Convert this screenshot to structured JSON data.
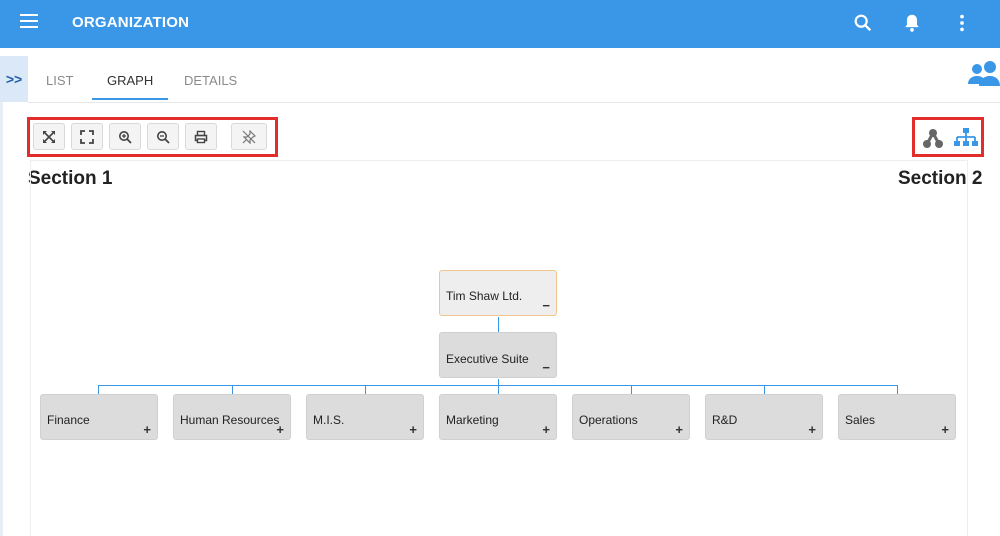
{
  "header": {
    "title": "ORGANIZATION",
    "icons": [
      "menu-icon",
      "search-icon",
      "bell-icon",
      "more-vertical-icon"
    ],
    "color": "#3a97e8"
  },
  "tabs": {
    "toggle": ">>",
    "items": [
      {
        "label": "LIST"
      },
      {
        "label": "GRAPH"
      },
      {
        "label": "DETAILS"
      }
    ],
    "active": "GRAPH"
  },
  "toolbar": {
    "buttons": [
      "expand-icon",
      "fullscreen-icon",
      "zoom-in-icon",
      "zoom-out-icon",
      "print-icon",
      "disable-pin-icon"
    ]
  },
  "layout_toggle": {
    "buttons": [
      "network-layout-icon",
      "hierarchy-layout-icon"
    ]
  },
  "annotations": {
    "section1": "Section 1",
    "section2": "Section 2"
  },
  "graph": {
    "root": {
      "label": "Tim Shaw Ltd.",
      "toggle": "−"
    },
    "exec": {
      "label": "Executive Suite",
      "toggle": "−"
    },
    "children": [
      {
        "label": "Finance",
        "toggle": "+"
      },
      {
        "label": "Human Resources",
        "toggle": "+"
      },
      {
        "label": "M.I.S.",
        "toggle": "+"
      },
      {
        "label": "Marketing",
        "toggle": "+"
      },
      {
        "label": "Operations",
        "toggle": "+"
      },
      {
        "label": "R&D",
        "toggle": "+"
      },
      {
        "label": "Sales",
        "toggle": "+"
      }
    ]
  }
}
